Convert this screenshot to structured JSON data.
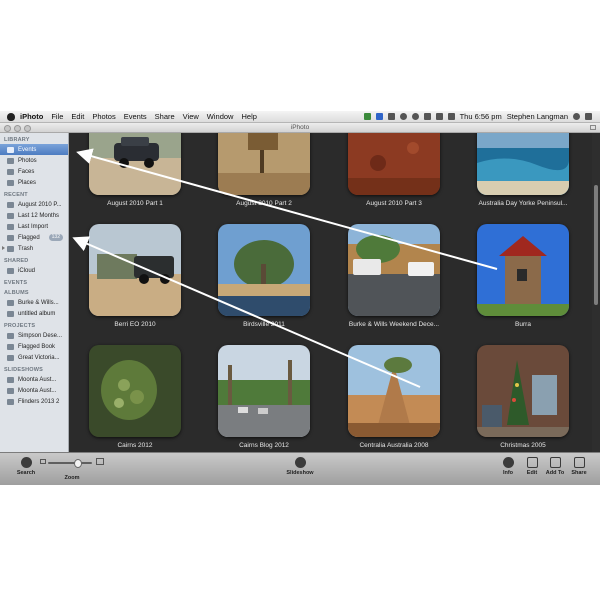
{
  "menubar": {
    "app_name": "iPhoto",
    "menus": [
      "File",
      "Edit",
      "Photos",
      "Events",
      "Share",
      "View",
      "Window",
      "Help"
    ],
    "clock": "Thu 6:56 pm",
    "user": "Stephen Langman"
  },
  "window": {
    "title": "iPhoto"
  },
  "sidebar": {
    "library_heading": "LIBRARY",
    "library": [
      {
        "label": "Events",
        "icon": "events-icon",
        "selected": true
      },
      {
        "label": "Photos",
        "icon": "photos-icon"
      },
      {
        "label": "Faces",
        "icon": "faces-icon"
      },
      {
        "label": "Places",
        "icon": "places-icon"
      }
    ],
    "recent_heading": "RECENT",
    "recent": [
      {
        "label": "August 2010 P...",
        "icon": "event-icon"
      },
      {
        "label": "Last 12 Months",
        "icon": "calendar-icon"
      },
      {
        "label": "Last Import",
        "icon": "import-icon"
      },
      {
        "label": "Flagged",
        "icon": "flag-icon",
        "badge": "132"
      },
      {
        "label": "Trash",
        "icon": "trash-icon"
      }
    ],
    "shared_heading": "SHARED",
    "shared": [
      {
        "label": "iCloud",
        "icon": "icloud-icon"
      }
    ],
    "events_heading": "EVENTS",
    "albums_heading": "ALBUMS",
    "albums": [
      {
        "label": "Burke & Wills...",
        "icon": "album-icon"
      },
      {
        "label": "untitled album",
        "icon": "album-icon"
      }
    ],
    "projects_heading": "PROJECTS",
    "projects": [
      {
        "label": "Simpson Dese...",
        "icon": "book-icon"
      },
      {
        "label": "Flagged Book",
        "icon": "book-icon"
      },
      {
        "label": "Great Victoria...",
        "icon": "book-icon"
      }
    ],
    "slideshows_heading": "SLIDESHOWS",
    "slideshows": [
      {
        "label": "Moonta Aust...",
        "icon": "slideshow-icon"
      },
      {
        "label": "Moonta Aust...",
        "icon": "slideshow-icon"
      },
      {
        "label": "Flinders 2013 2",
        "icon": "slideshow-icon"
      }
    ]
  },
  "events": [
    {
      "title": "August 2010 Part 1"
    },
    {
      "title": "August 2010 Part 2"
    },
    {
      "title": "August 2010 Part 3"
    },
    {
      "title": "Australia Day Yorke Peninsul..."
    },
    {
      "title": "Berri EO 2010"
    },
    {
      "title": "Birdsville 2011"
    },
    {
      "title": "Burke & Wills Weekend Dece..."
    },
    {
      "title": "Burra"
    },
    {
      "title": "Cairns 2012"
    },
    {
      "title": "Cairns Blog 2012"
    },
    {
      "title": "Centralia Australia 2008"
    },
    {
      "title": "Christmas 2005"
    }
  ],
  "toolbar": {
    "search": "Search",
    "zoom": "Zoom",
    "slideshow": "Slideshow",
    "info": "Info",
    "edit": "Edit",
    "add_to": "Add To",
    "share": "Share"
  }
}
